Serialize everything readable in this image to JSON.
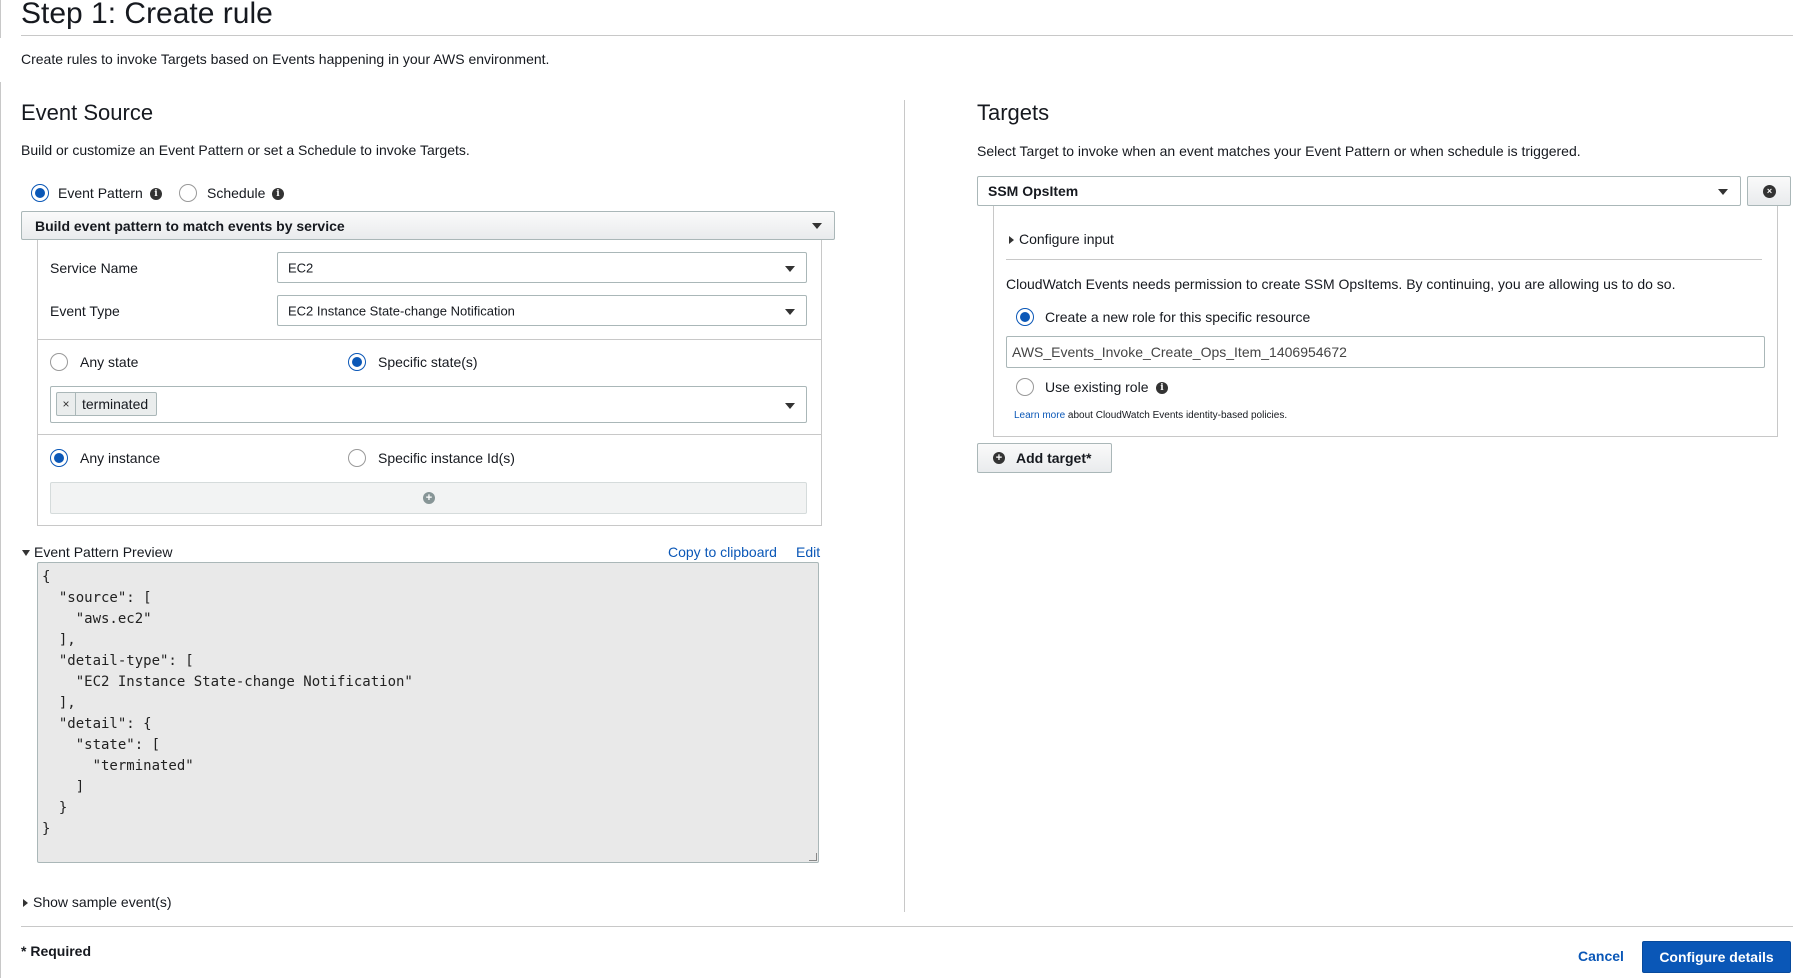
{
  "page": {
    "title": "Step 1: Create rule",
    "description": "Create rules to invoke Targets based on Events happening in your AWS environment."
  },
  "event_source": {
    "title": "Event Source",
    "description": "Build or customize an Event Pattern or set a Schedule to invoke Targets.",
    "mode_options": [
      {
        "label": "Event Pattern",
        "selected": true
      },
      {
        "label": "Schedule",
        "selected": false
      }
    ],
    "pattern_builder": "Build event pattern to match events by service",
    "service_name_label": "Service Name",
    "service_name_value": "EC2",
    "event_type_label": "Event Type",
    "event_type_value": "EC2 Instance State-change Notification",
    "state_options": [
      {
        "label": "Any state",
        "selected": false
      },
      {
        "label": "Specific state(s)",
        "selected": true
      }
    ],
    "state_token": "terminated",
    "token_remove": "×",
    "instance_options": [
      {
        "label": "Any instance",
        "selected": true
      },
      {
        "label": "Specific instance Id(s)",
        "selected": false
      }
    ],
    "add_icon": "plus-circle-icon"
  },
  "preview": {
    "label": "Event Pattern Preview",
    "copy_label": "Copy to clipboard",
    "edit_label": "Edit",
    "json_text": "{\n  \"source\": [\n    \"aws.ec2\"\n  ],\n  \"detail-type\": [\n    \"EC2 Instance State-change Notification\"\n  ],\n  \"detail\": {\n    \"state\": [\n      \"terminated\"\n    ]\n  }\n}",
    "sample_label": "Show sample event(s)"
  },
  "targets": {
    "title": "Targets",
    "description": "Select Target to invoke when an event matches your Event Pattern or when schedule is triggered.",
    "target_type": "SSM OpsItem",
    "configure_input": "Configure input",
    "permission_text": "CloudWatch Events needs permission to create SSM OpsItems. By continuing, you are allowing us to do so.",
    "role_options": [
      {
        "label": "Create a new role for this specific resource",
        "selected": true
      },
      {
        "label": "Use existing role",
        "selected": false
      }
    ],
    "role_name": "AWS_Events_Invoke_Create_Ops_Item_1406954672",
    "learn_more": "Learn more",
    "learn_more_suffix": "about CloudWatch Events identity-based policies.",
    "add_target": "Add target*"
  },
  "footer": {
    "required_note": "* Required",
    "cancel_label": "Cancel",
    "primary_label": "Configure details"
  },
  "colors": {
    "accent": "#0a57b7",
    "border": "#aab7b8",
    "preview_bg": "#e9e9e9"
  }
}
